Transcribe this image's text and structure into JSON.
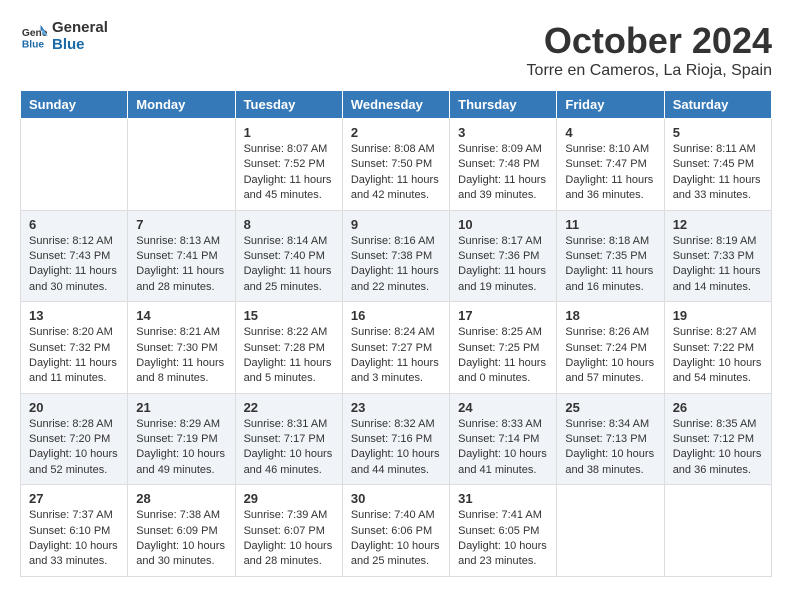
{
  "header": {
    "logo_line1": "General",
    "logo_line2": "Blue",
    "month": "October 2024",
    "location": "Torre en Cameros, La Rioja, Spain"
  },
  "weekdays": [
    "Sunday",
    "Monday",
    "Tuesday",
    "Wednesday",
    "Thursday",
    "Friday",
    "Saturday"
  ],
  "weeks": [
    [
      {
        "day": "",
        "info": ""
      },
      {
        "day": "",
        "info": ""
      },
      {
        "day": "1",
        "info": "Sunrise: 8:07 AM\nSunset: 7:52 PM\nDaylight: 11 hours and 45 minutes."
      },
      {
        "day": "2",
        "info": "Sunrise: 8:08 AM\nSunset: 7:50 PM\nDaylight: 11 hours and 42 minutes."
      },
      {
        "day": "3",
        "info": "Sunrise: 8:09 AM\nSunset: 7:48 PM\nDaylight: 11 hours and 39 minutes."
      },
      {
        "day": "4",
        "info": "Sunrise: 8:10 AM\nSunset: 7:47 PM\nDaylight: 11 hours and 36 minutes."
      },
      {
        "day": "5",
        "info": "Sunrise: 8:11 AM\nSunset: 7:45 PM\nDaylight: 11 hours and 33 minutes."
      }
    ],
    [
      {
        "day": "6",
        "info": "Sunrise: 8:12 AM\nSunset: 7:43 PM\nDaylight: 11 hours and 30 minutes."
      },
      {
        "day": "7",
        "info": "Sunrise: 8:13 AM\nSunset: 7:41 PM\nDaylight: 11 hours and 28 minutes."
      },
      {
        "day": "8",
        "info": "Sunrise: 8:14 AM\nSunset: 7:40 PM\nDaylight: 11 hours and 25 minutes."
      },
      {
        "day": "9",
        "info": "Sunrise: 8:16 AM\nSunset: 7:38 PM\nDaylight: 11 hours and 22 minutes."
      },
      {
        "day": "10",
        "info": "Sunrise: 8:17 AM\nSunset: 7:36 PM\nDaylight: 11 hours and 19 minutes."
      },
      {
        "day": "11",
        "info": "Sunrise: 8:18 AM\nSunset: 7:35 PM\nDaylight: 11 hours and 16 minutes."
      },
      {
        "day": "12",
        "info": "Sunrise: 8:19 AM\nSunset: 7:33 PM\nDaylight: 11 hours and 14 minutes."
      }
    ],
    [
      {
        "day": "13",
        "info": "Sunrise: 8:20 AM\nSunset: 7:32 PM\nDaylight: 11 hours and 11 minutes."
      },
      {
        "day": "14",
        "info": "Sunrise: 8:21 AM\nSunset: 7:30 PM\nDaylight: 11 hours and 8 minutes."
      },
      {
        "day": "15",
        "info": "Sunrise: 8:22 AM\nSunset: 7:28 PM\nDaylight: 11 hours and 5 minutes."
      },
      {
        "day": "16",
        "info": "Sunrise: 8:24 AM\nSunset: 7:27 PM\nDaylight: 11 hours and 3 minutes."
      },
      {
        "day": "17",
        "info": "Sunrise: 8:25 AM\nSunset: 7:25 PM\nDaylight: 11 hours and 0 minutes."
      },
      {
        "day": "18",
        "info": "Sunrise: 8:26 AM\nSunset: 7:24 PM\nDaylight: 10 hours and 57 minutes."
      },
      {
        "day": "19",
        "info": "Sunrise: 8:27 AM\nSunset: 7:22 PM\nDaylight: 10 hours and 54 minutes."
      }
    ],
    [
      {
        "day": "20",
        "info": "Sunrise: 8:28 AM\nSunset: 7:20 PM\nDaylight: 10 hours and 52 minutes."
      },
      {
        "day": "21",
        "info": "Sunrise: 8:29 AM\nSunset: 7:19 PM\nDaylight: 10 hours and 49 minutes."
      },
      {
        "day": "22",
        "info": "Sunrise: 8:31 AM\nSunset: 7:17 PM\nDaylight: 10 hours and 46 minutes."
      },
      {
        "day": "23",
        "info": "Sunrise: 8:32 AM\nSunset: 7:16 PM\nDaylight: 10 hours and 44 minutes."
      },
      {
        "day": "24",
        "info": "Sunrise: 8:33 AM\nSunset: 7:14 PM\nDaylight: 10 hours and 41 minutes."
      },
      {
        "day": "25",
        "info": "Sunrise: 8:34 AM\nSunset: 7:13 PM\nDaylight: 10 hours and 38 minutes."
      },
      {
        "day": "26",
        "info": "Sunrise: 8:35 AM\nSunset: 7:12 PM\nDaylight: 10 hours and 36 minutes."
      }
    ],
    [
      {
        "day": "27",
        "info": "Sunrise: 7:37 AM\nSunset: 6:10 PM\nDaylight: 10 hours and 33 minutes."
      },
      {
        "day": "28",
        "info": "Sunrise: 7:38 AM\nSunset: 6:09 PM\nDaylight: 10 hours and 30 minutes."
      },
      {
        "day": "29",
        "info": "Sunrise: 7:39 AM\nSunset: 6:07 PM\nDaylight: 10 hours and 28 minutes."
      },
      {
        "day": "30",
        "info": "Sunrise: 7:40 AM\nSunset: 6:06 PM\nDaylight: 10 hours and 25 minutes."
      },
      {
        "day": "31",
        "info": "Sunrise: 7:41 AM\nSunset: 6:05 PM\nDaylight: 10 hours and 23 minutes."
      },
      {
        "day": "",
        "info": ""
      },
      {
        "day": "",
        "info": ""
      }
    ]
  ]
}
